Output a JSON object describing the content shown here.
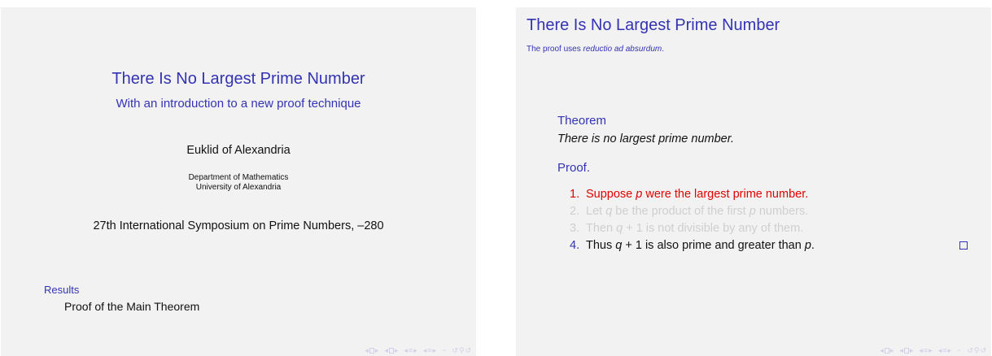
{
  "title_slide": {
    "title": "There Is No Largest Prime Number",
    "subtitle": "With an introduction to a new proof technique",
    "author": "Euklid of Alexandria",
    "institute_line1": "Department of Mathematics",
    "institute_line2": "University of Alexandria",
    "date": "27th International Symposium on Prime Numbers, –280",
    "section": "Results",
    "subsection": "Proof of the Main Theorem"
  },
  "content_slide": {
    "frame_title": "There Is No Largest Prime Number",
    "frame_subtitle_pre": "The proof uses ",
    "frame_subtitle_em": "reductio ad absurdum",
    "frame_subtitle_post": ".",
    "theorem_header": "Theorem",
    "theorem_body": "There is no largest prime number.",
    "proof_header": "Proof.",
    "steps": [
      {
        "num": "1.",
        "parts": [
          "Suppose ",
          "p",
          " were the largest prime number."
        ]
      },
      {
        "num": "2.",
        "parts": [
          "Let ",
          "q",
          " be the product of the first ",
          "p",
          " numbers."
        ]
      },
      {
        "num": "3.",
        "parts": [
          "Then ",
          "q",
          " + 1 is not divisible by any of them."
        ]
      },
      {
        "num": "4.",
        "parts": [
          "Thus ",
          "q",
          " + 1 is also prime and greater than ",
          "p",
          "."
        ]
      }
    ]
  },
  "nav": {
    "left_arrow": "◂",
    "right_arrow": "▸",
    "circle_arrows": "↺",
    "menu": "≡",
    "sep": "−",
    "search": "⚲"
  },
  "colors": {
    "structure": "#3333b3",
    "alert": "#e00000",
    "dimmed": "#cfcfcf",
    "slide_bg": "#f2f2f2"
  }
}
